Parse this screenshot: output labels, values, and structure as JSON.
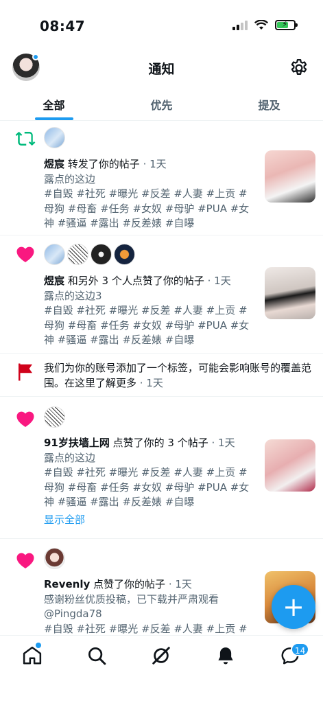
{
  "status_bar": {
    "time": "08:47"
  },
  "header": {
    "title": "通知"
  },
  "tabs": [
    {
      "label": "全部",
      "active": true
    },
    {
      "label": "优先",
      "active": false
    },
    {
      "label": "提及",
      "active": false
    }
  ],
  "notifications": [
    {
      "type": "retweet",
      "user": "煜宸",
      "action": " 转发了你的帖子",
      "time": " · 1天",
      "title": "露点的这边",
      "tags": "#自毁 #社死 #曝光 #反差 #人妻 #上贡 #母狗 #母畜 #任务 #女奴 #母驴 #PUA #女神 #骚逼 #露出 #反差婊 #自曝"
    },
    {
      "type": "like",
      "user": "煜宸",
      "action": " 和另外 3 个人点赞了你的帖子",
      "time": " · 1天",
      "title": "露点的这边3",
      "tags": "#自毁 #社死 #曝光 #反差 #人妻 #上贡 #母狗 #母畜 #任务 #女奴 #母驴 #PUA #女神 #骚逼 #露出 #反差婊 #自曝"
    },
    {
      "type": "flag",
      "text": "我们为你的账号添加了一个标签，可能会影响账号的覆盖范围。在这里了解更多",
      "time": " · 1天"
    },
    {
      "type": "like",
      "user": "91岁扶墙上网",
      "action": " 点赞了你的 3 个帖子",
      "time": " · 1天",
      "title": "露点的这边",
      "tags": "#自毁 #社死 #曝光 #反差 #人妻 #上贡 #母狗 #母畜 #任务 #女奴 #母驴 #PUA #女神 #骚逼 #露出 #反差婊 #自曝",
      "show_all": "显示全部"
    },
    {
      "type": "like",
      "user": "Revenly",
      "action": " 点赞了你的帖子",
      "time": " · 1天",
      "title": "感谢粉丝优质投稿，已下载并严肃观看 @Pingda78",
      "tags": "#自毁 #社死 #曝光 #反差 #人妻 #上贡 #母"
    }
  ],
  "fab": {
    "label": "+"
  },
  "bottom_nav": {
    "messages_badge": "14"
  },
  "colors": {
    "accent": "#1d9bf0",
    "like": "#f91880",
    "retweet": "#00ba7c",
    "flag": "#d0021b"
  }
}
